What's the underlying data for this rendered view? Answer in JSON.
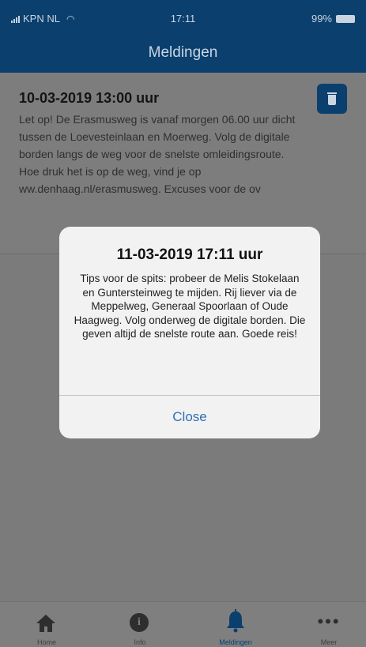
{
  "status_bar": {
    "carrier": "KPN NL",
    "time": "17:11",
    "battery": "99%"
  },
  "header": {
    "title": "Meldingen"
  },
  "message": {
    "date": "10-03-2019 13:00 uur",
    "body": "Let op! De Erasmusweg is vanaf morgen 06.00 uur dicht tussen de Loevesteinlaan en Moerweg. Volg de digitale borden langs de weg voor de snelste omleidingsroute. Hoe druk het is op de weg, vind je op ww.denhaag.nl/erasmusweg. Excuses voor de ov"
  },
  "alert": {
    "title": "11-03-2019 17:11 uur",
    "body": "Tips voor de spits: probeer de Melis Stokelaan en Guntersteinweg te mijden. Rij liever via de Meppelweg, Generaal Spoorlaan of Oude Haagweg. Volg onderweg de digitale borden. Die geven altijd de snelste route aan. Goede reis!",
    "close_label": "Close"
  },
  "tabbar": {
    "items": [
      {
        "label": "Home",
        "icon": "home-icon"
      },
      {
        "label": "Info",
        "icon": "info-icon"
      },
      {
        "label": "Meldingen",
        "icon": "bell-icon"
      },
      {
        "label": "Meer",
        "icon": "more-icon"
      }
    ]
  },
  "colors": {
    "header": "#0b3f6e",
    "link": "#2f6fb5"
  }
}
